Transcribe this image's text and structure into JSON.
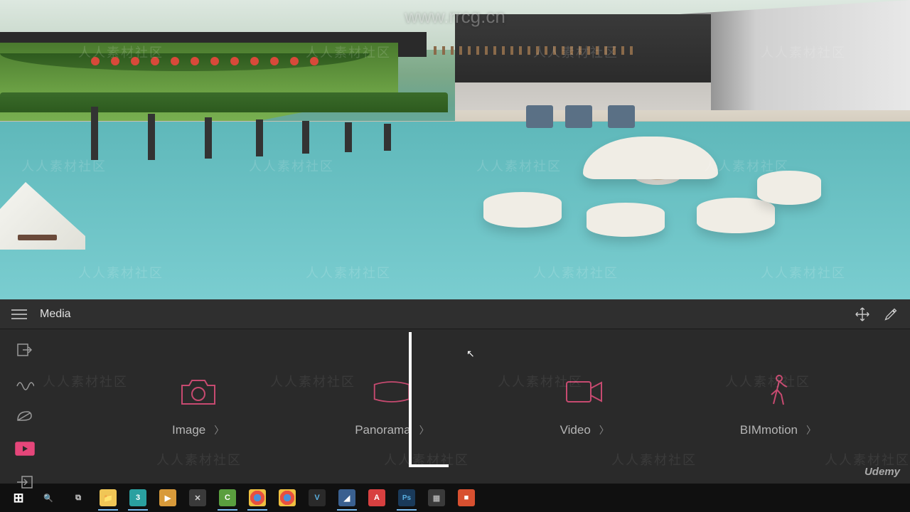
{
  "watermark_url": "www.rrcg.cn",
  "watermark_text": "人人素材社区",
  "toolbar": {
    "title": "Media"
  },
  "side_icons": [
    {
      "name": "import-icon"
    },
    {
      "name": "path-icon"
    },
    {
      "name": "leaf-icon"
    },
    {
      "name": "media-icon"
    },
    {
      "name": "export-icon"
    }
  ],
  "media_options": [
    {
      "name": "image-option",
      "label": "Image",
      "icon": "camera"
    },
    {
      "name": "panorama-option",
      "label": "Panorama",
      "icon": "panorama"
    },
    {
      "name": "video-option",
      "label": "Video",
      "icon": "video"
    },
    {
      "name": "bimmotion-option",
      "label": "BIMmotion",
      "icon": "walk"
    }
  ],
  "taskbar": [
    {
      "name": "start",
      "bg": "#000",
      "glyph": "⊞"
    },
    {
      "name": "search",
      "bg": "#000",
      "glyph": "🔍"
    },
    {
      "name": "taskview",
      "bg": "#000",
      "glyph": "▭"
    },
    {
      "name": "explorer",
      "bg": "#f0c656",
      "glyph": "📁",
      "running": true
    },
    {
      "name": "3dsmax",
      "bg": "#2aa0a0",
      "glyph": "3",
      "running": true
    },
    {
      "name": "player",
      "bg": "#d89a3a",
      "glyph": "▶"
    },
    {
      "name": "app-x",
      "bg": "#3a3a3a",
      "glyph": "✕"
    },
    {
      "name": "camtasia",
      "bg": "#5a9e3e",
      "glyph": "C",
      "running": true
    },
    {
      "name": "chrome",
      "bg": "#2a2a2a",
      "glyph": "◉",
      "running": true
    },
    {
      "name": "chrome2",
      "bg": "#2a2a2a",
      "glyph": "◉"
    },
    {
      "name": "vray",
      "bg": "#2a2a2a",
      "glyph": "V"
    },
    {
      "name": "sketchup",
      "bg": "#3a6090",
      "glyph": "◢",
      "running": true
    },
    {
      "name": "autocad",
      "bg": "#d84040",
      "glyph": "A"
    },
    {
      "name": "photoshop",
      "bg": "#1a3a5a",
      "glyph": "Ps",
      "running": true
    },
    {
      "name": "aftereffects",
      "bg": "#3a3a3a",
      "glyph": "▦"
    },
    {
      "name": "app-red",
      "bg": "#d85030",
      "glyph": "■"
    }
  ],
  "brand": "Udemy"
}
